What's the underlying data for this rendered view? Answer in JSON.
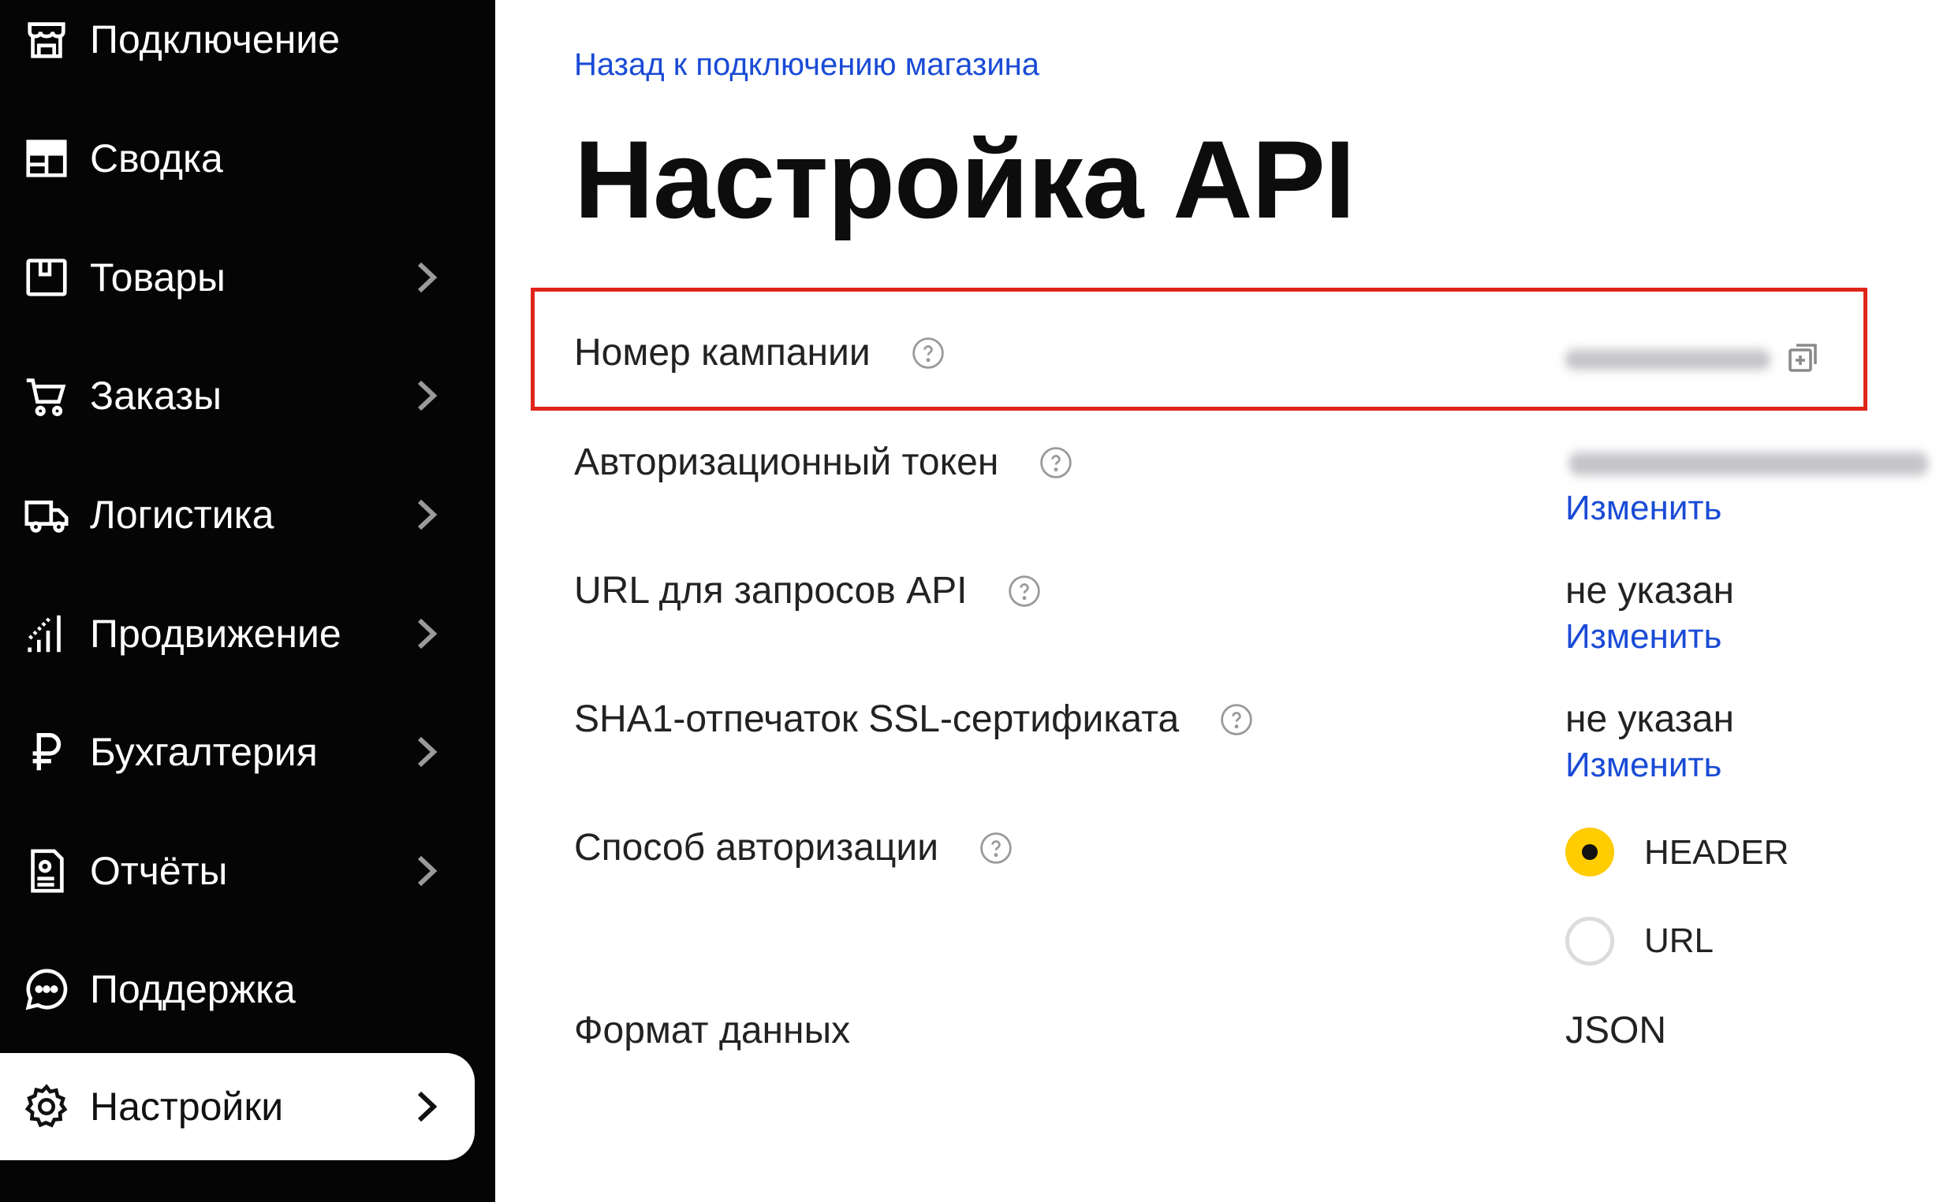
{
  "sidebar": {
    "items": [
      {
        "label": "Подключение",
        "icon": "store-icon"
      },
      {
        "label": "Сводка",
        "icon": "dashboard-icon"
      },
      {
        "label": "Товары",
        "icon": "box-icon"
      },
      {
        "label": "Заказы",
        "icon": "cart-icon"
      },
      {
        "label": "Логистика",
        "icon": "truck-icon"
      },
      {
        "label": "Продвижение",
        "icon": "chart-icon"
      },
      {
        "label": "Бухгалтерия",
        "icon": "ruble-icon"
      },
      {
        "label": "Отчёты",
        "icon": "report-icon"
      },
      {
        "label": "Поддержка",
        "icon": "chat-icon"
      },
      {
        "label": "Настройки",
        "icon": "gear-icon",
        "active": true
      }
    ]
  },
  "main": {
    "back_link": "Назад к подключению магазина",
    "title": "Настройка API",
    "rows": {
      "campaign": {
        "label": "Номер кампании"
      },
      "token": {
        "label": "Авторизационный токен",
        "action": "Изменить"
      },
      "url": {
        "label": "URL для запросов API",
        "value": "не указан",
        "action": "Изменить"
      },
      "sha1": {
        "label": "SHA1-отпечаток SSL-сертификата",
        "value": "не указан",
        "action": "Изменить"
      },
      "auth": {
        "label": "Способ авторизации",
        "options": [
          {
            "label": "HEADER",
            "selected": true
          },
          {
            "label": "URL",
            "selected": false
          }
        ]
      },
      "format": {
        "label": "Формат данных",
        "value": "JSON"
      }
    }
  },
  "colors": {
    "sidebar_bg": "#050505",
    "link": "#1a4bd6",
    "highlight_border": "#e0241a",
    "radio_selected": "#ffcc00"
  }
}
